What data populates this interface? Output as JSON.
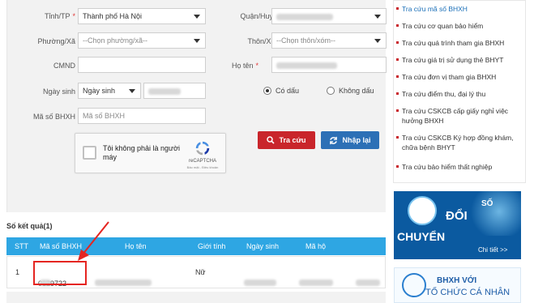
{
  "form": {
    "province_label": "Tỉnh/TP",
    "required_mark": "*",
    "province_value": "Thành phố Hà Nội",
    "district_label": "Quận/Huyện",
    "ward_label": "Phường/Xã",
    "ward_value": "--Chọn phường/xã--",
    "village_label": "Thôn/Xóm",
    "village_value": "--Chọn thôn/xóm--",
    "id_label": "CMND",
    "name_label": "Họ tên",
    "dob_label": "Ngày sinh",
    "dob_select": "Ngày sinh",
    "accent_option": "Có dấu",
    "no_accent_option": "Không dấu",
    "accent_selected": true,
    "bhxh_label": "Mã số BHXH",
    "bhxh_placeholder": "Mã số BHXH"
  },
  "captcha": {
    "text": "Tôi không phải là người máy",
    "brand": "reCAPTCHA",
    "sub": "Bảo mật - Điều khoản"
  },
  "buttons": {
    "search_label": "Tra cứu",
    "reset_label": "Nhập lại"
  },
  "results": {
    "title": "Số kết quả(1)",
    "columns": [
      "STT",
      "Mã số BHXH",
      "Họ tên",
      "Giới tính",
      "Ngày sinh",
      "Mã hộ"
    ],
    "row": {
      "stt": "1",
      "bhxh": "0129722",
      "gender": "Nữ"
    }
  },
  "sidebar": {
    "items": [
      "Tra cứu mã số BHXH",
      "Tra cứu cơ quan bảo hiểm",
      "Tra cứu quá trình tham gia BHXH",
      "Tra cứu giá trị sử dụng thẻ BHYT",
      "Tra cứu đơn vị tham gia BHXH",
      "Tra cứu điểm thu, đại lý thu",
      "Tra cứu CSKCB cấp giấy nghỉ việc hưởng BHXH",
      "Tra cứu CSKCB Ký hợp đồng khám, chữa bệnh BHYT",
      "Tra cứu bảo hiểm thất nghiệp"
    ]
  },
  "banner1": {
    "so": "SỐ",
    "hoa": "ĐỔI",
    "doi": "CHUYỂN",
    "detail": "Chi tiết >>"
  },
  "banner2": {
    "line1": "BHXH VỚI",
    "line2": "TỔ CHỨC CÁ NHÂN"
  },
  "colors": {
    "accent_red": "#c9252b",
    "accent_blue": "#2c70b6",
    "table_header": "#2ea6e3",
    "highlight": "#e52521"
  }
}
